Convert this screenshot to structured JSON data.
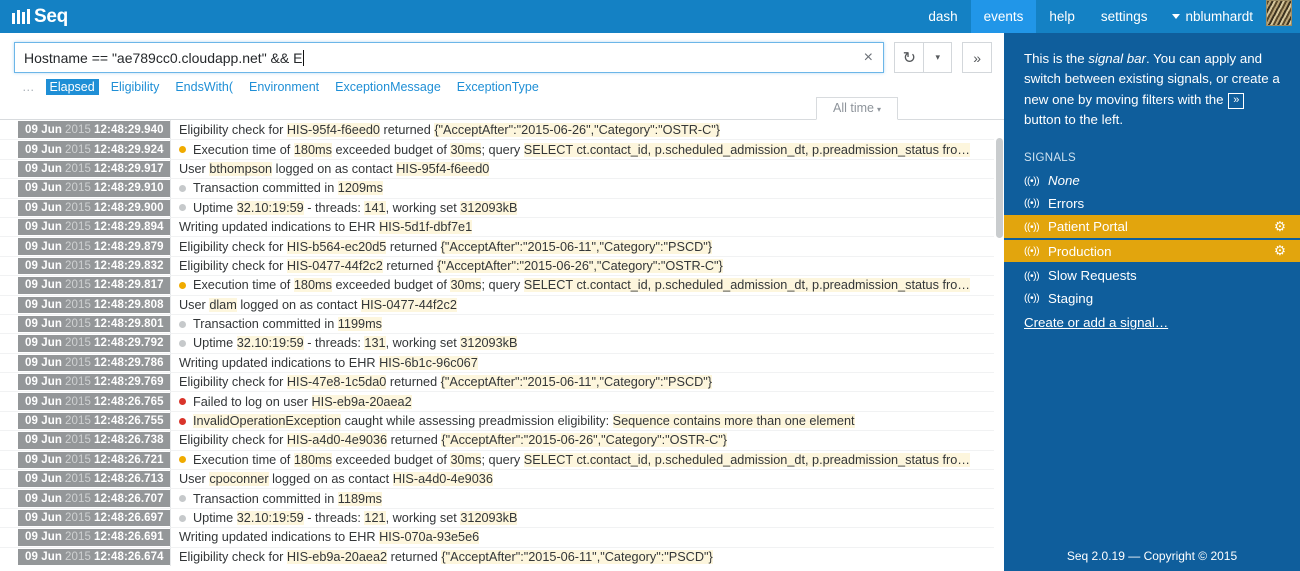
{
  "brand": {
    "name": "Seq",
    "logo_icon": "bars-logo-icon"
  },
  "nav": {
    "items": [
      {
        "label": "dash",
        "active": false
      },
      {
        "label": "events",
        "active": true
      },
      {
        "label": "help",
        "active": false
      },
      {
        "label": "settings",
        "active": false
      }
    ],
    "user": "nblumhardt"
  },
  "search": {
    "query": "Hostname  ==  \"ae789cc0.cloudapp.net\" && E",
    "clear_icon": "×",
    "refresh_icon": "↻",
    "refresh_caret_icon": "▾",
    "expand_icon": "»"
  },
  "suggestions": {
    "ellipsis": "…",
    "items": [
      {
        "label": "Elapsed",
        "selected": true
      },
      {
        "label": "Eligibility",
        "selected": false
      },
      {
        "label": "EndsWith(",
        "selected": false
      },
      {
        "label": "Environment",
        "selected": false
      },
      {
        "label": "ExceptionMessage",
        "selected": false
      },
      {
        "label": "ExceptionType",
        "selected": false
      }
    ]
  },
  "time_tab": {
    "label": "All time",
    "caret": "▾"
  },
  "events": [
    {
      "date": "09 Jun",
      "year": "2015",
      "time": "12:48:29.940",
      "level": "none",
      "parts": [
        {
          "t": "Eligibility check for ",
          "h": false
        },
        {
          "t": "HIS-95f4-f6eed0",
          "h": true
        },
        {
          "t": " returned ",
          "h": false
        },
        {
          "t": "{\"AcceptAfter\":\"2015-06-26\",\"Category\":\"OSTR-C\"}",
          "h": true
        }
      ]
    },
    {
      "date": "09 Jun",
      "year": "2015",
      "time": "12:48:29.924",
      "level": "warn",
      "parts": [
        {
          "t": "Execution time of ",
          "h": false
        },
        {
          "t": "180ms",
          "h": true
        },
        {
          "t": " exceeded budget of ",
          "h": false
        },
        {
          "t": "30ms",
          "h": true
        },
        {
          "t": "; query ",
          "h": false
        },
        {
          "t": "SELECT ct.contact_id, p.scheduled_admission_dt, p.preadmission_status fro…",
          "h": true
        }
      ]
    },
    {
      "date": "09 Jun",
      "year": "2015",
      "time": "12:48:29.917",
      "level": "none",
      "parts": [
        {
          "t": "User ",
          "h": false
        },
        {
          "t": "bthompson",
          "h": true
        },
        {
          "t": " logged on as contact ",
          "h": false
        },
        {
          "t": "HIS-95f4-f6eed0",
          "h": true
        }
      ]
    },
    {
      "date": "09 Jun",
      "year": "2015",
      "time": "12:48:29.910",
      "level": "debug",
      "parts": [
        {
          "t": "Transaction committed in ",
          "h": false
        },
        {
          "t": "1209ms",
          "h": true
        }
      ]
    },
    {
      "date": "09 Jun",
      "year": "2015",
      "time": "12:48:29.900",
      "level": "debug",
      "parts": [
        {
          "t": "Uptime ",
          "h": false
        },
        {
          "t": "32.10:19:59",
          "h": true
        },
        {
          "t": " - threads: ",
          "h": false
        },
        {
          "t": "141",
          "h": true
        },
        {
          "t": ", working set ",
          "h": false
        },
        {
          "t": "312093kB",
          "h": true
        }
      ]
    },
    {
      "date": "09 Jun",
      "year": "2015",
      "time": "12:48:29.894",
      "level": "none",
      "parts": [
        {
          "t": "Writing updated indications to EHR ",
          "h": false
        },
        {
          "t": "HIS-5d1f-dbf7e1",
          "h": true
        }
      ]
    },
    {
      "date": "09 Jun",
      "year": "2015",
      "time": "12:48:29.879",
      "level": "none",
      "parts": [
        {
          "t": "Eligibility check for ",
          "h": false
        },
        {
          "t": "HIS-b564-ec20d5",
          "h": true
        },
        {
          "t": " returned ",
          "h": false
        },
        {
          "t": "{\"AcceptAfter\":\"2015-06-11\",\"Category\":\"PSCD\"}",
          "h": true
        }
      ]
    },
    {
      "date": "09 Jun",
      "year": "2015",
      "time": "12:48:29.832",
      "level": "none",
      "parts": [
        {
          "t": "Eligibility check for ",
          "h": false
        },
        {
          "t": "HIS-0477-44f2c2",
          "h": true
        },
        {
          "t": " returned ",
          "h": false
        },
        {
          "t": "{\"AcceptAfter\":\"2015-06-26\",\"Category\":\"OSTR-C\"}",
          "h": true
        }
      ]
    },
    {
      "date": "09 Jun",
      "year": "2015",
      "time": "12:48:29.817",
      "level": "warn",
      "parts": [
        {
          "t": "Execution time of ",
          "h": false
        },
        {
          "t": "180ms",
          "h": true
        },
        {
          "t": " exceeded budget of ",
          "h": false
        },
        {
          "t": "30ms",
          "h": true
        },
        {
          "t": "; query ",
          "h": false
        },
        {
          "t": "SELECT ct.contact_id, p.scheduled_admission_dt, p.preadmission_status fro…",
          "h": true
        }
      ]
    },
    {
      "date": "09 Jun",
      "year": "2015",
      "time": "12:48:29.808",
      "level": "none",
      "parts": [
        {
          "t": "User ",
          "h": false
        },
        {
          "t": "dlam",
          "h": true
        },
        {
          "t": " logged on as contact ",
          "h": false
        },
        {
          "t": "HIS-0477-44f2c2",
          "h": true
        }
      ]
    },
    {
      "date": "09 Jun",
      "year": "2015",
      "time": "12:48:29.801",
      "level": "debug",
      "parts": [
        {
          "t": "Transaction committed in ",
          "h": false
        },
        {
          "t": "1199ms",
          "h": true
        }
      ]
    },
    {
      "date": "09 Jun",
      "year": "2015",
      "time": "12:48:29.792",
      "level": "debug",
      "parts": [
        {
          "t": "Uptime ",
          "h": false
        },
        {
          "t": "32.10:19:59",
          "h": true
        },
        {
          "t": " - threads: ",
          "h": false
        },
        {
          "t": "131",
          "h": true
        },
        {
          "t": ", working set ",
          "h": false
        },
        {
          "t": "312093kB",
          "h": true
        }
      ]
    },
    {
      "date": "09 Jun",
      "year": "2015",
      "time": "12:48:29.786",
      "level": "none",
      "parts": [
        {
          "t": "Writing updated indications to EHR ",
          "h": false
        },
        {
          "t": "HIS-6b1c-96c067",
          "h": true
        }
      ]
    },
    {
      "date": "09 Jun",
      "year": "2015",
      "time": "12:48:29.769",
      "level": "none",
      "parts": [
        {
          "t": "Eligibility check for ",
          "h": false
        },
        {
          "t": "HIS-47e8-1c5da0",
          "h": true
        },
        {
          "t": " returned ",
          "h": false
        },
        {
          "t": "{\"AcceptAfter\":\"2015-06-11\",\"Category\":\"PSCD\"}",
          "h": true
        }
      ]
    },
    {
      "date": "09 Jun",
      "year": "2015",
      "time": "12:48:26.765",
      "level": "error",
      "parts": [
        {
          "t": "Failed to log on user ",
          "h": false
        },
        {
          "t": "HIS-eb9a-20aea2",
          "h": true
        }
      ]
    },
    {
      "date": "09 Jun",
      "year": "2015",
      "time": "12:48:26.755",
      "level": "error",
      "parts": [
        {
          "t": "InvalidOperationException",
          "h": true
        },
        {
          "t": " caught while assessing preadmission eligibility: ",
          "h": false
        },
        {
          "t": "Sequence contains more than one element",
          "h": true
        }
      ]
    },
    {
      "date": "09 Jun",
      "year": "2015",
      "time": "12:48:26.738",
      "level": "none",
      "parts": [
        {
          "t": "Eligibility check for ",
          "h": false
        },
        {
          "t": "HIS-a4d0-4e9036",
          "h": true
        },
        {
          "t": " returned ",
          "h": false
        },
        {
          "t": "{\"AcceptAfter\":\"2015-06-26\",\"Category\":\"OSTR-C\"}",
          "h": true
        }
      ]
    },
    {
      "date": "09 Jun",
      "year": "2015",
      "time": "12:48:26.721",
      "level": "warn",
      "parts": [
        {
          "t": "Execution time of ",
          "h": false
        },
        {
          "t": "180ms",
          "h": true
        },
        {
          "t": " exceeded budget of ",
          "h": false
        },
        {
          "t": "30ms",
          "h": true
        },
        {
          "t": "; query ",
          "h": false
        },
        {
          "t": "SELECT ct.contact_id, p.scheduled_admission_dt, p.preadmission_status fro…",
          "h": true
        }
      ]
    },
    {
      "date": "09 Jun",
      "year": "2015",
      "time": "12:48:26.713",
      "level": "none",
      "parts": [
        {
          "t": "User ",
          "h": false
        },
        {
          "t": "cpoconner",
          "h": true
        },
        {
          "t": " logged on as contact ",
          "h": false
        },
        {
          "t": "HIS-a4d0-4e9036",
          "h": true
        }
      ]
    },
    {
      "date": "09 Jun",
      "year": "2015",
      "time": "12:48:26.707",
      "level": "debug",
      "parts": [
        {
          "t": "Transaction committed in ",
          "h": false
        },
        {
          "t": "1189ms",
          "h": true
        }
      ]
    },
    {
      "date": "09 Jun",
      "year": "2015",
      "time": "12:48:26.697",
      "level": "debug",
      "parts": [
        {
          "t": "Uptime ",
          "h": false
        },
        {
          "t": "32.10:19:59",
          "h": true
        },
        {
          "t": " - threads: ",
          "h": false
        },
        {
          "t": "121",
          "h": true
        },
        {
          "t": ", working set ",
          "h": false
        },
        {
          "t": "312093kB",
          "h": true
        }
      ]
    },
    {
      "date": "09 Jun",
      "year": "2015",
      "time": "12:48:26.691",
      "level": "none",
      "parts": [
        {
          "t": "Writing updated indications to EHR ",
          "h": false
        },
        {
          "t": "HIS-070a-93e5e6",
          "h": true
        }
      ]
    },
    {
      "date": "09 Jun",
      "year": "2015",
      "time": "12:48:26.674",
      "level": "none",
      "parts": [
        {
          "t": "Eligibility check for ",
          "h": false
        },
        {
          "t": "HIS-eb9a-20aea2",
          "h": true
        },
        {
          "t": " returned ",
          "h": false
        },
        {
          "t": "{\"AcceptAfter\":\"2015-06-11\",\"Category\":\"PSCD\"}",
          "h": true
        }
      ]
    }
  ],
  "signalbar": {
    "intro_before": "This is the ",
    "intro_em": "signal bar",
    "intro_mid": ". You can apply and switch between existing signals, or create a new one by moving filters with the ",
    "intro_button_glyph": "»",
    "intro_after": " button to the left.",
    "heading": "SIGNALS",
    "signal_icon": "((•))",
    "gear_icon": "⚙",
    "items": [
      {
        "label": "None",
        "active": false,
        "italic": true,
        "gear": false
      },
      {
        "label": "Errors",
        "active": false,
        "italic": false,
        "gear": false
      },
      {
        "label": "Patient Portal",
        "active": true,
        "italic": false,
        "gear": true
      },
      {
        "label": "Production",
        "active": true,
        "italic": false,
        "gear": true
      },
      {
        "label": "Slow Requests",
        "active": false,
        "italic": false,
        "gear": false
      },
      {
        "label": "Staging",
        "active": false,
        "italic": false,
        "gear": false
      }
    ],
    "create_link": "Create or add a signal…",
    "footer": "Seq 2.0.19 — Copyright © 2015"
  },
  "colors": {
    "brand_blue": "#1481c4",
    "nav_active": "#2196e8",
    "signalbar_blue": "#0f5e9c",
    "signal_active": "#e2a50d",
    "warn": "#f0ab00",
    "error": "#d9342b",
    "debug": "#c6c9cb",
    "highlight": "#fdf6dd",
    "timestamp_bg": "#949799"
  }
}
